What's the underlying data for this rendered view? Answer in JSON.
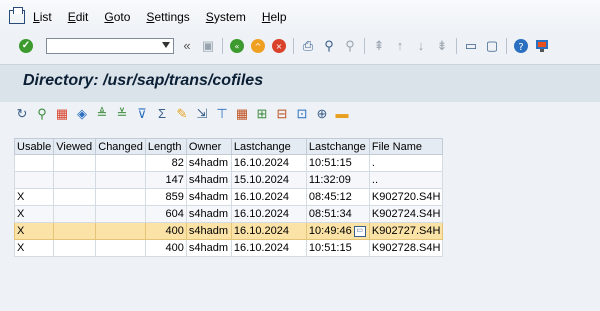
{
  "menu": [
    {
      "label": "List",
      "underline": "L",
      "rest": "ist"
    },
    {
      "label": "Edit",
      "underline": "E",
      "rest": "dit"
    },
    {
      "label": "Goto",
      "underline": "G",
      "rest": "oto"
    },
    {
      "label": "Settings",
      "underline": "S",
      "rest": "ettings"
    },
    {
      "label": "System",
      "underline": "S",
      "rest": "ystem"
    },
    {
      "label": "Help",
      "underline": "H",
      "rest": "elp"
    }
  ],
  "command_field": {
    "value": "",
    "placeholder": ""
  },
  "page_title": "Directory: /usr/sap/trans/cofiles",
  "table": {
    "columns": [
      "Usable",
      "Viewed",
      "Changed",
      "Length",
      "Owner",
      "Lastchange",
      "Lastchange",
      "File Name"
    ],
    "rows": [
      {
        "usable": "",
        "viewed": "",
        "changed": "",
        "length": "82",
        "owner": "s4hadm",
        "date": "16.10.2024",
        "time": "10:51:15",
        "file": "."
      },
      {
        "usable": "",
        "viewed": "",
        "changed": "",
        "length": "147",
        "owner": "s4hadm",
        "date": "15.10.2024",
        "time": "11:32:09",
        "file": ".."
      },
      {
        "usable": "X",
        "viewed": "",
        "changed": "",
        "length": "859",
        "owner": "s4hadm",
        "date": "16.10.2024",
        "time": "08:45:12",
        "file": "K902720.S4H"
      },
      {
        "usable": "X",
        "viewed": "",
        "changed": "",
        "length": "604",
        "owner": "s4hadm",
        "date": "16.10.2024",
        "time": "08:51:34",
        "file": "K902724.S4H"
      },
      {
        "usable": "X",
        "viewed": "",
        "changed": "",
        "length": "400",
        "owner": "s4hadm",
        "date": "16.10.2024",
        "time": "10:49:46",
        "file": "K902727.S4H"
      },
      {
        "usable": "X",
        "viewed": "",
        "changed": "",
        "length": "400",
        "owner": "s4hadm",
        "date": "16.10.2024",
        "time": "10:51:15",
        "file": "K902728.S4H"
      }
    ],
    "selected_row": 4
  },
  "colors": {
    "selected_row": "#fbe3a8",
    "title_bar": "#dbe3ea",
    "background": "#eef2f6"
  }
}
